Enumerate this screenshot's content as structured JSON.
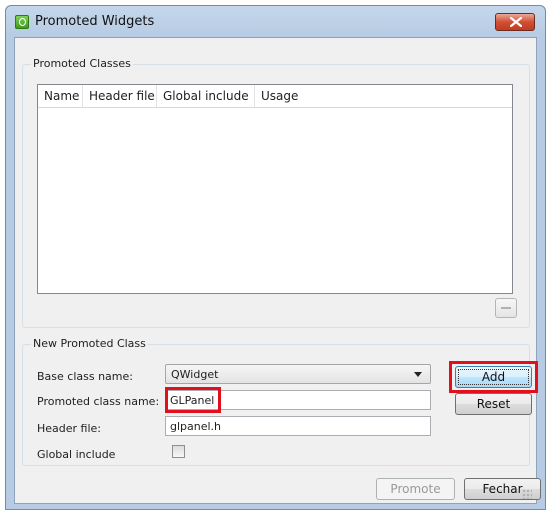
{
  "window": {
    "title": "Promoted Widgets",
    "icon": "qt-designer-icon",
    "close_icon": "close-icon"
  },
  "promoted_classes": {
    "group_title": "Promoted Classes",
    "columns": [
      "Name",
      "Header file",
      "Global include",
      "Usage"
    ],
    "rows": [],
    "remove_icon": "minus-icon"
  },
  "new_promoted_class": {
    "group_title": "New Promoted Class",
    "base_class_label": "Base class name:",
    "base_class_value": "QWidget",
    "promoted_class_label": "Promoted class name:",
    "promoted_class_value": "GLPanel",
    "header_file_label": "Header file:",
    "header_file_value": "glpanel.h",
    "global_include_label": "Global include",
    "global_include_checked": false,
    "add_label": "Add",
    "reset_label": "Reset"
  },
  "footer": {
    "promote_label": "Promote",
    "close_label": "Fechar"
  },
  "colors": {
    "highlight": "#e0101c",
    "title_bar": "#b7cce4",
    "close_button": "#c13c21"
  }
}
